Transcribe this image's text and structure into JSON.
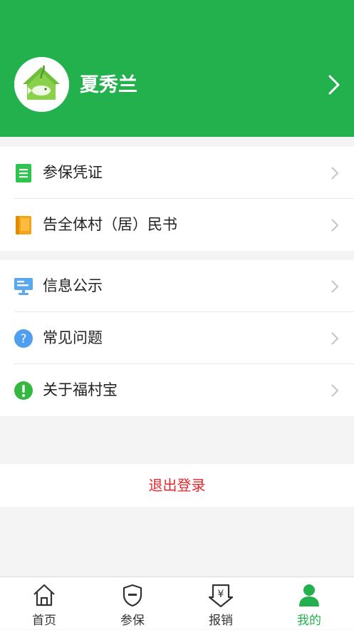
{
  "header": {
    "username": "夏秀兰",
    "avatar_icon": "house-fish-logo-icon",
    "arrow_icon": "chevron-right-icon",
    "background": "#23b14d"
  },
  "menu_groups": [
    {
      "items": [
        {
          "label": "参保凭证",
          "icon": "document-icon",
          "color": "#2ec44f"
        },
        {
          "label": "告全体村（居）民书",
          "icon": "book-icon",
          "color": "#f5a318"
        }
      ]
    },
    {
      "items": [
        {
          "label": "信息公示",
          "icon": "billboard-icon",
          "color": "#5aa8f0"
        },
        {
          "label": "常见问题",
          "icon": "question-icon",
          "color": "#4f9ff0"
        },
        {
          "label": "关于福村宝",
          "icon": "exclamation-icon",
          "color": "#35b83f"
        }
      ]
    }
  ],
  "logout": {
    "label": "退出登录",
    "color": "#e8262b"
  },
  "tabbar": {
    "active_color": "#23b14d",
    "tabs": [
      {
        "label": "首页",
        "icon": "home-icon",
        "active": false
      },
      {
        "label": "参保",
        "icon": "shield-icon",
        "active": false
      },
      {
        "label": "报销",
        "icon": "yuan-receipt-icon",
        "active": false
      },
      {
        "label": "我的",
        "icon": "person-icon",
        "active": true
      }
    ]
  }
}
